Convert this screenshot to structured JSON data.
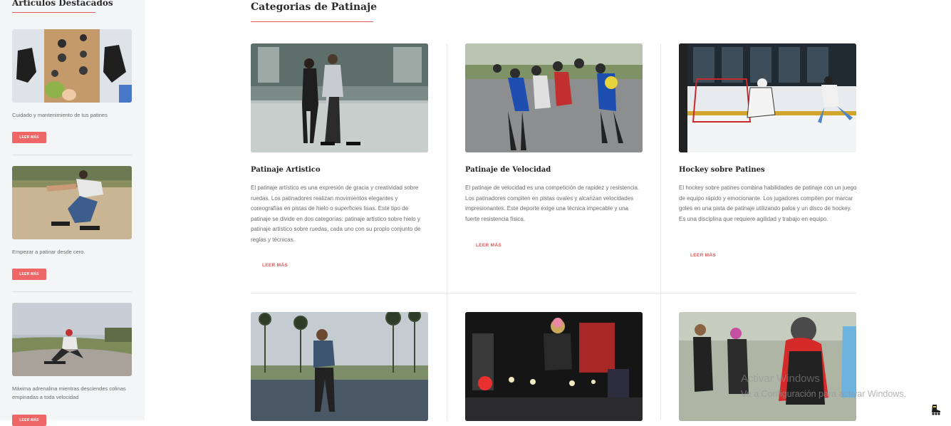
{
  "sidebar": {
    "title": "Articulos Destacados",
    "cards": [
      {
        "description": "Cuidado y mantenimiento de tus patines",
        "button": "LEER MÁS"
      },
      {
        "description": "Empezar a patinar desde cero.",
        "button": "LEER MÁS"
      },
      {
        "description": "Máxima adrenalina mientras desciendes colinas empinadas a toda velocidad",
        "button": "LEER MÁS"
      }
    ]
  },
  "main": {
    "title": "Categorias de Patinaje",
    "categories": [
      {
        "title": "Patinaje Artistico",
        "text": "El patinaje artístico es una expresión de gracia y creatividad sobre ruedas. Los patinadores realizan movimientos elegantes y coreografías en pistas de hielo o superficies lisas. Este tipo de patinaje se divide en dos categorías: patinaje artístico sobre hielo y patinaje artístico sobre ruedas, cada uno con su propio conjunto de reglas y técnicas.",
        "link": "LEER MÁS"
      },
      {
        "title": "Patinaje de Velocidad",
        "text": "El patinaje de velocidad es una competición de rapidez y resistencia. Los patinadores compiten en pistas ovales y alcanzan velocidades impresionantes. Este deporte exige una técnica impecable y una fuerte resistencia física.",
        "link": "LEER MÁS"
      },
      {
        "title": "Hockey sobre Patines",
        "text": "El hockey sobre patines combina habilidades de patinaje con un juego de equipo rápido y emocionante. Los jugadores compiten por marcar goles en una pista de patinaje utilizando palos y un disco de hockey. Es una disciplina que requiere agilidad y trabajo en equipo.",
        "link": "LEER MÁS"
      }
    ]
  },
  "watermark": {
    "line1": "Activar Windows",
    "line2": "Ve a Configuración para activar Windows."
  },
  "colors": {
    "accent": "#e05a5a",
    "button": "#ee6666",
    "sidebar_bg": "#f4f5f7"
  },
  "icons": {
    "corner": "skate-icon"
  }
}
